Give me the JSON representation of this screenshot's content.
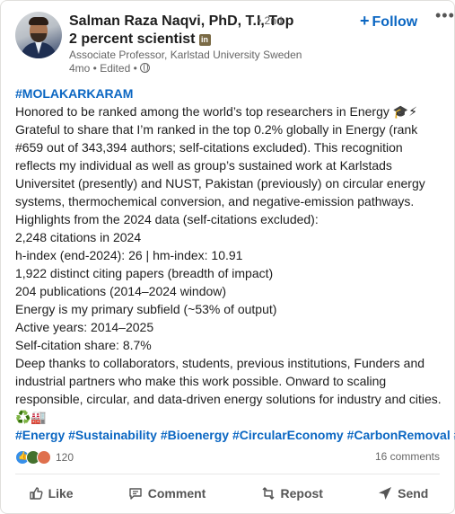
{
  "author": {
    "name": "Salman Raza Naqvi, PhD, T.I, Top 2 percent scientist",
    "badge": "in",
    "degree": "• 2nd",
    "headline": "Associate Professor, Karlstad University Sweden",
    "meta": "4mo • Edited •"
  },
  "follow_label": "Follow",
  "more_label": "•••",
  "post": {
    "lines": [
      "#MOLAKARKARAM",
      "Honored to be ranked among the world’s top researchers in Energy 🎓⚡",
      "Grateful to share that I’m ranked in the top 0.2% globally in Energy (rank",
      "#659 out of 343,394 authors; self-citations excluded). This recognition",
      "reflects my individual as well as group’s sustained work at Karlstads",
      "Universitet (presently) and NUST, Pakistan (previously) on circular energy",
      "systems, thermochemical conversion, and negative-emission pathways.",
      "Highlights from the 2024 data (self-citations excluded):",
      "2,248 citations in 2024",
      "h-index (end-2024): 26 | hm-index: 10.91",
      "1,922 distinct citing papers (breadth of impact)",
      "204 publications (2014–2024 window)",
      "Energy is my primary subfield (~53% of output)",
      "Active years: 2014–2025",
      "Self-citation share: 8.7%",
      "Deep thanks to collaborators, students, previous institutions, Funders and",
      "industrial partners who make this work possible. Onward to scaling",
      "responsible, circular, and data-driven energy solutions for industry and cities.",
      "♻️🏭"
    ],
    "hashtags": "#Energy #Sustainability #Bioenergy #CircularEconomy #CarbonRemoval #T"
  },
  "social": {
    "reaction_count": "120",
    "comments": "16 comments"
  },
  "actions": {
    "like": "Like",
    "comment": "Comment",
    "repost": "Repost",
    "send": "Send"
  },
  "colors": {
    "link": "#0a66c2",
    "text": "#1d1d1d",
    "muted": "#666666"
  }
}
